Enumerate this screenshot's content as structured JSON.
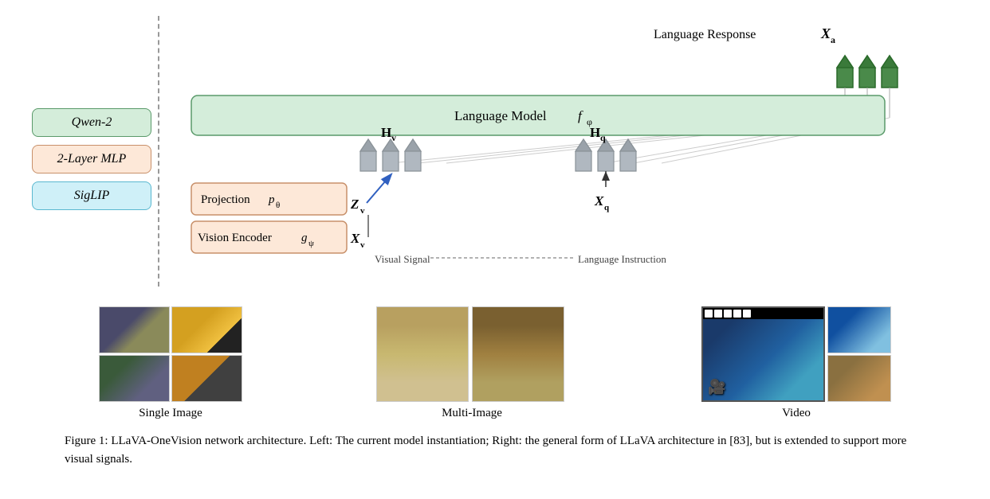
{
  "figure": {
    "title": "Figure 1: LLaVA-OneVision network architecture. Left: The current model instantiation; Right: the general form of LLaVA architecture in [83], but is extended to support more visual signals.",
    "left_panel": {
      "boxes": [
        {
          "label": "Qwen-2",
          "style": "green"
        },
        {
          "label": "2-Layer MLP",
          "style": "peach"
        },
        {
          "label": "SigLIP",
          "style": "cyan"
        }
      ]
    },
    "right_panel": {
      "language_response_label": "Language Response",
      "Xa_label": "X",
      "Xa_sub": "a",
      "language_model_label": "Language Model",
      "language_model_math": "f",
      "language_model_sub": "φ",
      "projection_label": "Projection",
      "projection_math": "p",
      "projection_sub": "θ",
      "vision_encoder_label": "Vision Encoder",
      "vision_encoder_math": "g",
      "vision_encoder_sub": "ψ",
      "Zv_label": "Z",
      "Zv_sub": "v",
      "Hv_label": "H",
      "Hv_sub": "v",
      "Hq_label": "H",
      "Hq_sub": "q",
      "Xv_label": "X",
      "Xv_sub": "v",
      "Xq_label": "X",
      "Xq_sub": "q",
      "visual_signal_label": "Visual Signal",
      "language_instruction_label": "Language Instruction"
    },
    "bottom": {
      "single_image_label": "Single Image",
      "multi_image_label": "Multi-Image",
      "video_label": "Video"
    }
  }
}
